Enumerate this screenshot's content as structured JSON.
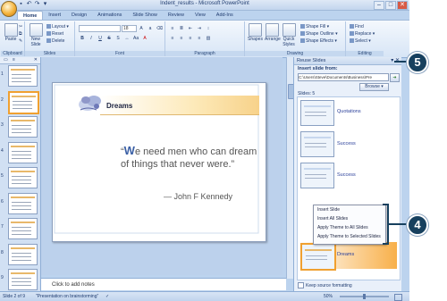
{
  "window": {
    "title": "Indent_results - Microsoft PowerPoint",
    "controls": [
      "–",
      "□",
      "✕"
    ]
  },
  "quick_access": [
    "save",
    "undo",
    "redo",
    "customize"
  ],
  "tabs": [
    "Home",
    "Insert",
    "Design",
    "Animations",
    "Slide Show",
    "Review",
    "View",
    "Add-Ins"
  ],
  "ribbon": {
    "clipboard": {
      "paste": "Paste",
      "label": "Clipboard"
    },
    "slides": {
      "new_slide": "New Slide",
      "layout": "Layout",
      "reset": "Reset",
      "delete": "Delete",
      "label": "Slides"
    },
    "font": {
      "font_name": "",
      "font_size": "18",
      "label": "Font"
    },
    "paragraph": {
      "label": "Paragraph"
    },
    "drawing": {
      "shapes": "Shapes",
      "arrange": "Arrange",
      "quick_styles": "Quick Styles",
      "shape_fill": "Shape Fill",
      "shape_outline": "Shape Outline",
      "shape_effects": "Shape Effects",
      "label": "Drawing"
    },
    "editing": {
      "find": "Find",
      "replace": "Replace",
      "select": "Select",
      "label": "Editing"
    }
  },
  "slide": {
    "title": "Dreams",
    "quote_first_letter": "W",
    "quote_rest": "e need men who can dream of things that never were.”",
    "quote_open": "“",
    "author": "— John F Kennedy"
  },
  "notes_placeholder": "Click to add notes",
  "thumbnails": {
    "count": 9,
    "selected": 2,
    "numbers": [
      "1",
      "2",
      "3",
      "4",
      "5",
      "6",
      "7",
      "8",
      "9"
    ]
  },
  "reuse_pane": {
    "title": "Reuse Slides",
    "insert_label": "Insert slide from:",
    "path": "C:\\Users\\Steve\\Documents\\Business\\Pre",
    "browse": "Browse ▾",
    "slides_count": "Slides: 5",
    "slides": [
      {
        "label": "Quotations"
      },
      {
        "label": "Success"
      },
      {
        "label": "Success"
      },
      {
        "label": "Dreams"
      }
    ],
    "keep_formatting": "Keep source formatting"
  },
  "context_menu": [
    "Insert Slide",
    "Insert All Slides",
    "Apply Theme to All Slides",
    "Apply Theme to Selected Slides"
  ],
  "status_bar": {
    "slide_info": "Slide 2 of 9",
    "theme": "\"Presentation on brainstorming\"",
    "zoom": "50%"
  },
  "callouts": [
    "5",
    "4"
  ]
}
